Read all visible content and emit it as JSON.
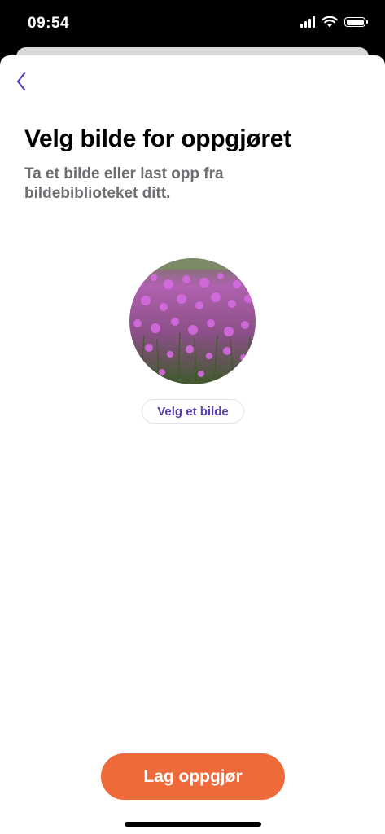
{
  "status_bar": {
    "time": "09:54",
    "icons": [
      "cellular-signal-icon",
      "wifi-icon",
      "battery-icon"
    ]
  },
  "nav": {
    "back_icon": "chevron-left-icon"
  },
  "content": {
    "title": "Velg bilde for oppgjøret",
    "subtitle": "Ta et bilde eller last opp fra bildebiblioteket ditt.",
    "choose_image_label": "Velg et bilde"
  },
  "footer": {
    "primary_button_label": "Lag oppgjør"
  },
  "colors": {
    "accent": "#5b3fb8",
    "primary_button": "#ee6a3a",
    "subtitle_text": "#6e6e73"
  }
}
